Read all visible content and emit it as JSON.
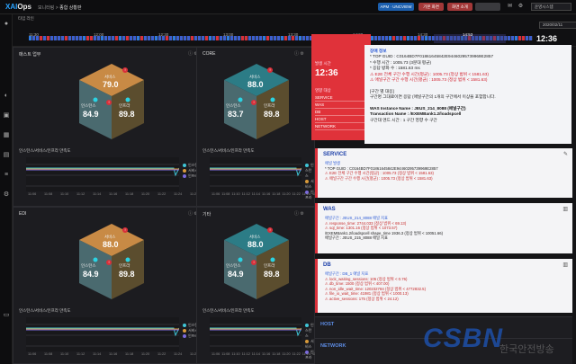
{
  "topbar": {
    "logo_prefix": "XAI",
    "logo_suffix": "Ops",
    "crumb_parent": "모니터링",
    "crumb_current": "종합 상황판",
    "btn1": "APM · UNCVIEW",
    "btn2": "기본 화면",
    "btn3": "화면 소개",
    "btn4": "",
    "select": "운영시스템"
  },
  "sidebar": {
    "items": [
      "user-icon",
      "dashboard-icon",
      "chart-icon",
      "grid-icon",
      "document-icon",
      "list-icon",
      "gear-icon"
    ]
  },
  "timeline": {
    "title": "타임 라인",
    "ticks": [
      "11:30",
      "12:00",
      "12:30",
      "13:00",
      "13:30",
      "14:00",
      "14:30",
      "15:00"
    ],
    "selected_time": "14:53",
    "clock": "12:36",
    "date": "2020/02/11"
  },
  "panels": [
    {
      "title": "매스트 업무",
      "service_lbl": "서비스",
      "service_val": "79.0",
      "instance_lbl": "인스턴스",
      "instance_val": "84.9",
      "infra_lbl": "인프라",
      "infra_val": "89.8",
      "chart_title": "인스턴스/서비스/인프라 만족도",
      "badge": "!",
      "times": [
        "11:06",
        "11:08",
        "11:10",
        "11:12",
        "11:14",
        "11:16",
        "11:18",
        "11:20",
        "11:22",
        "11:24",
        "11:26"
      ]
    },
    {
      "title": "CORE",
      "service_lbl": "서비스",
      "service_val": "88.0",
      "instance_lbl": "인스턴스",
      "instance_val": "83.7",
      "infra_lbl": "인프라",
      "infra_val": "89.8",
      "chart_title": "인스턴스/서비스/인프라 만족도",
      "badge": "!",
      "times": [
        "11:06",
        "11:08",
        "11:10",
        "11:12",
        "11:14",
        "11:16",
        "11:18",
        "11:20",
        "11:22",
        "11:24",
        "11:26"
      ]
    },
    {
      "title": "EDI",
      "service_lbl": "서비스",
      "service_val": "88.0",
      "instance_lbl": "인스턴스",
      "instance_val": "84.9",
      "infra_lbl": "인프라",
      "infra_val": "89.8",
      "chart_title": "인스턴스/서비스/인프라 만족도",
      "badge": "!",
      "times": [
        "11:06",
        "11:08",
        "11:10",
        "11:12",
        "11:14",
        "11:16",
        "11:18",
        "11:20",
        "11:22",
        "11:24",
        "11:26"
      ]
    },
    {
      "title": "기타",
      "service_lbl": "서비스",
      "service_val": "88.0",
      "instance_lbl": "인스턴스",
      "instance_val": "84.9",
      "infra_lbl": "인프라",
      "infra_val": "89.8",
      "chart_title": "인스턴스/서비스/인프라 만족도",
      "badge": "!",
      "times": [
        "11:06",
        "11:08",
        "11:10",
        "11:12",
        "11:14",
        "11:16",
        "11:18",
        "11:20",
        "11:22",
        "11:24",
        "11:26"
      ]
    }
  ],
  "legend": [
    "인스턴스",
    "서비스",
    "인프라"
  ],
  "colors": {
    "accent": "#2ba3ff",
    "alert": "#d9303a",
    "line_cyan": "#3fc5d6",
    "line_orange": "#d89a3a",
    "line_purple": "#7c6be0"
  },
  "popup": {
    "occur_lbl": "발생 시간",
    "occur_time": "12:36",
    "rows_title": "영향 대상",
    "rows": [
      {
        "k": "SERVICE",
        "v": "1"
      },
      {
        "k": "WAS",
        "v": "4"
      },
      {
        "k": "DB",
        "v": "1"
      },
      {
        "k": "HOST",
        "v": "0"
      },
      {
        "k": "NETWORK",
        "v": "0"
      }
    ]
  },
  "detail": {
    "title": "장애 정보",
    "lines": [
      "* TOP GUID : C0164BD7F01861645842E94460295739969E2857",
      "* 수행 시간 : 1005.73 (3분대 평균)",
      "* 응답 방화 수 : 1581.63 ms",
      "⚠ E2E 전체 구간 수행 시간(평균) : 1005.73 (정상 범위 < 1581.63)",
      "⚠ 애널구간 구간 수행 시간(평균) : 1005.73 (정상 범위 < 1581.63)",
      "",
      "[구간 별 대응]",
      "구간명 그대로이면 응답 (애널구간의 1개의 구간에서 이상을 포함합니다.",
      "",
      "WAS Instance Name : JEUS_214_8088 (애널구간)",
      "Transaction Name : /EXEMBank1.2/loadspcell",
      "구간대 엔드 시간 : 1 구간 영향 수 구간"
    ]
  },
  "cards": [
    {
      "title": "SERVICE",
      "lines": [
        "애널 발생",
        "* TOP GUID : C0164BD7F01861645842E94460295739969E2857",
        "⚠ E2E 전체 구간 수행 시간(평균) : 1005.73 (정상 범위 < 1581.63)",
        "⚠ 애널구간 구간 수행 시간(평균) : 1005.73 (정상 범위 < 1581.63)"
      ]
    },
    {
      "title": "WAS",
      "lines": [
        "애널구간 : JEUS_214_8088 애널 지표",
        "⚠ response_time: 2744.033 (정상 범위 < 69.13)",
        "⚠ sql_time: 1301.16 (정상 범위 < 1073.57)",
        "/EXEMBank1.2/loadspcell shape_time 1936.3 (정상 범위 < 10051.66)",
        "애널구간 : JEUS_215_8088 애널 지표"
      ]
    },
    {
      "title": "DB",
      "lines": [
        "애널구간 : DB_1 애널 지표",
        "⚠ lock_waiting_sessions: 105 (정상 범위 < 0.76)",
        "⚠ db_time: 1500 (정상 범위 < 407.00)",
        "⚠ non_idle_wait_time: 120232784 (정상 범위 < 4772832.5)",
        "⚠ file_io_wait_time: 41981 (정상 범위 < 1000.13)",
        "⚠ active_sessions: 175 (정상 범위 < 24.12)"
      ]
    }
  ],
  "dark_cards": [
    {
      "title": "HOST"
    },
    {
      "title": "NETWORK"
    }
  ],
  "watermark": "CSBN",
  "watermark2": "한국안전방송"
}
